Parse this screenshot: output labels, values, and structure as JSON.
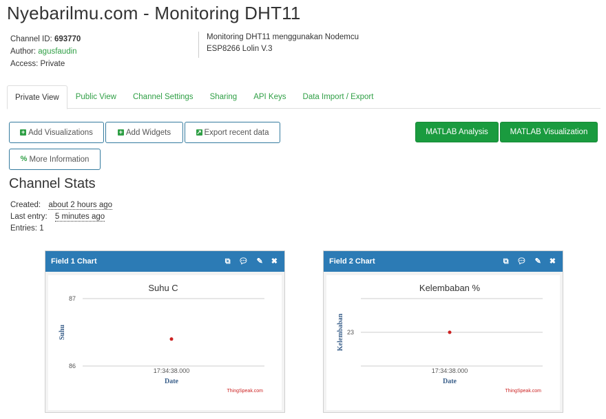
{
  "page": {
    "title": "Nyebarilmu.com - Monitoring DHT11"
  },
  "channel": {
    "id_label": "Channel ID:",
    "id_value": "693770",
    "author_label": "Author:",
    "author_value": "agusfaudin",
    "access_label": "Access:",
    "access_value": "Private",
    "description_line1": "Monitoring DHT11 menggunakan Nodemcu",
    "description_line2": "ESP8266 Lolin V.3"
  },
  "tabs": [
    {
      "label": "Private View",
      "active": true
    },
    {
      "label": "Public View"
    },
    {
      "label": "Channel Settings"
    },
    {
      "label": "Sharing"
    },
    {
      "label": "API Keys"
    },
    {
      "label": "Data Import / Export"
    }
  ],
  "actions": {
    "add_visualizations": "Add Visualizations",
    "add_widgets": "Add Widgets",
    "export_recent": "Export recent data",
    "more_information": "More Information",
    "matlab_analysis": "MATLAB Analysis",
    "matlab_visualization": "MATLAB Visualization"
  },
  "stats": {
    "heading": "Channel Stats",
    "created_label": "Created:",
    "created_value": "about 2 hours ago",
    "last_entry_label": "Last entry:",
    "last_entry_value": "5 minutes ago",
    "entries_label": "Entries:",
    "entries_value": "1"
  },
  "colors": {
    "accent_green": "#2f9f45",
    "card_header_blue": "#2c7bb5",
    "point_red": "#cc2222"
  },
  "icons": [
    "external-link-icon",
    "comment-icon",
    "pencil-icon",
    "close-icon",
    "plus-square-icon",
    "export-icon",
    "link-icon"
  ],
  "chart_data": [
    {
      "type": "scatter",
      "card_title": "Field 1 Chart",
      "title": "Suhu C",
      "xlabel": "Date",
      "ylabel": "Suhu",
      "y_ticks": [
        "87",
        "86"
      ],
      "x_ticks": [
        "17:34:38.000"
      ],
      "ylim": [
        86,
        87
      ],
      "points": [
        {
          "x": "17:34:38.000",
          "y": 86.4
        }
      ],
      "credit": "ThingSpeak.com"
    },
    {
      "type": "scatter",
      "card_title": "Field 2 Chart",
      "title": "Kelembaban %",
      "xlabel": "Date",
      "ylabel": "Kelembaban",
      "y_ticks": [
        "23"
      ],
      "x_ticks": [
        "17:34:38.000"
      ],
      "ylim": [
        22,
        24
      ],
      "points": [
        {
          "x": "17:34:38.000",
          "y": 23
        }
      ],
      "credit": "ThingSpeak.com"
    }
  ]
}
